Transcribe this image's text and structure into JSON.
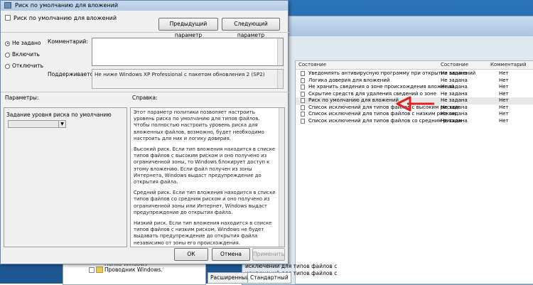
{
  "background_window": {
    "columns": [
      "Состояние",
      "Состояние",
      "Комментарий"
    ],
    "rows": [
      {
        "name": "Уведомлять антивирусную программу при открытии вложений",
        "state": "Не задана",
        "comment": "Нет"
      },
      {
        "name": "Логика доверия для вложений",
        "state": "Не задана",
        "comment": "Нет"
      },
      {
        "name": "Не хранить сведения о зоне происхождения вложений",
        "state": "Не задана",
        "comment": "Нет"
      },
      {
        "name": "Скрытие средств для удаления сведений о зоне",
        "state": "Не задана",
        "comment": "Нет"
      },
      {
        "name": "Риск по умолчанию для вложений",
        "state": "Не задана",
        "comment": "Нет"
      },
      {
        "name": "Список исключений для типов файлов с высоким риском",
        "state": "Не задана",
        "comment": "Нет"
      },
      {
        "name": "Список исключений для типов файлов с низким риском",
        "state": "Не задана",
        "comment": "Нет"
      },
      {
        "name": "Список исключений для типов файлов со средним риском",
        "state": "Не задана",
        "comment": "Нет"
      }
    ],
    "tree_items": [
      "Папка Windows",
      "Проводник Windows."
    ],
    "snippets": [
      "исключений для типов файлов с",
      "исключений для типов файлов с"
    ],
    "tabs": [
      "Расширенный",
      "Стандартный"
    ],
    "arrow_color": "#e02020"
  },
  "dialog": {
    "title": "Риск по умолчанию для вложений",
    "subtitle": "Риск по умолчанию для вложений",
    "prev_button": "Предыдущий параметр",
    "next_button": "Следующий параметр",
    "radios": [
      {
        "label": "Не задано",
        "checked": true
      },
      {
        "label": "Включить",
        "checked": false
      },
      {
        "label": "Отключить",
        "checked": false
      }
    ],
    "comment_label": "Комментарий:",
    "supported_label": "Поддерживается:",
    "supported_value": "Не ниже Windows XP Professional с пакетом обновления 2 (SP2)",
    "params_label": "Параметры:",
    "help_label": "Справка:",
    "param_name": "Задание уровня риска по умолчанию",
    "help_paragraphs": [
      "Этот параметр политики позволяет настроить уровень риска по умолчанию для типов файлов. Чтобы полностью настроить уровень риска для вложенных файлов, возможно, будет необходимо настроить для них и логику доверия.",
      "Высокий риск. Если тип вложения находится в списке типов файлов с высоким риском и оно получено из ограниченной зоны, то Windows блокирует доступ к этому вложению. Если файл получен из зоны Интернета, Windows выдаст предупреждение до открытия файла.",
      "Средний риск. Если тип вложения находится в списке типов файлов со средним риском и оно получено из ограниченной зоны или Интернет, Windows выдаст предупреждение до открытия файла.",
      "Низкий риск. Если тип вложения находится в списке типов файлов с низким риском, Windows не будет выдавать предупреждение до открытия файла независимо от зоны его происхождения."
    ],
    "ok_button": "ОК",
    "cancel_button": "Отмена",
    "apply_button": "Применить"
  }
}
